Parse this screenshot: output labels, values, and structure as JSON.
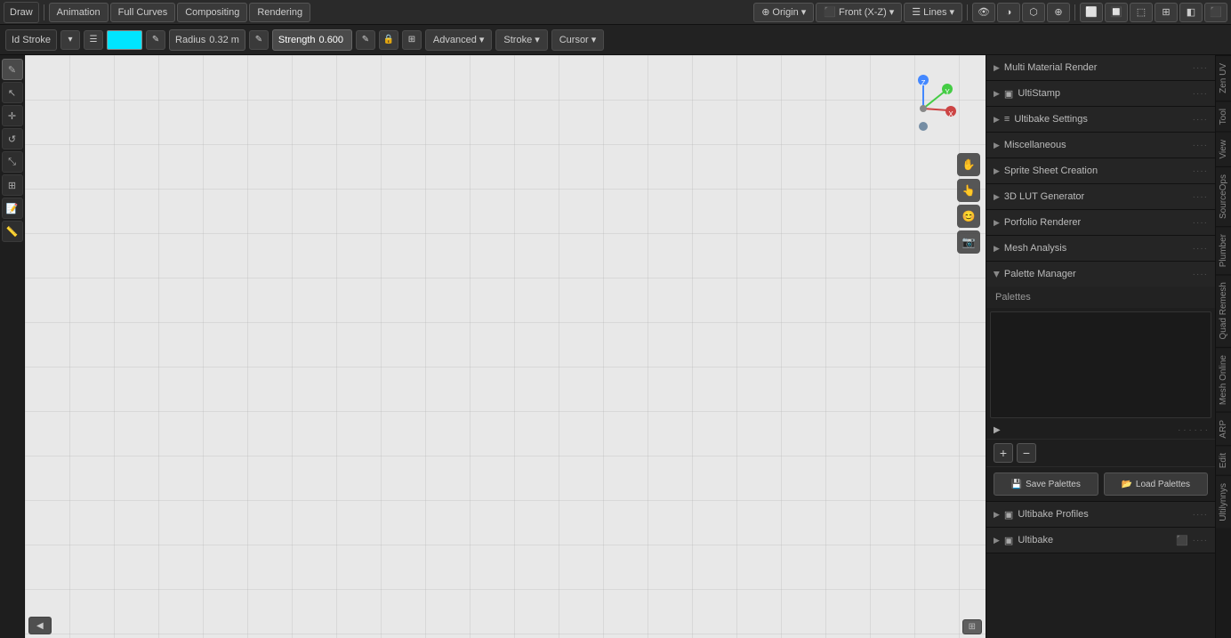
{
  "top_toolbar": {
    "mode_label": "Draw",
    "tabs": [
      "Animation",
      "Full Curves",
      "Compositing",
      "Rendering"
    ],
    "origin_label": "Origin",
    "view_label": "Front (X-Z)",
    "overlay_label": "Lines"
  },
  "secondary_toolbar": {
    "stroke_mode": "Id Stroke",
    "radius_label": "Radius",
    "radius_value": "0.32 m",
    "strength_label": "Strength",
    "strength_value": "0.600",
    "advanced_label": "Advanced",
    "stroke_label": "Stroke",
    "cursor_label": "Cursor"
  },
  "right_panel": {
    "sections": [
      {
        "id": "multi-material-render",
        "label": "Multi Material Render",
        "icon": "",
        "collapsed": true
      },
      {
        "id": "ulti-stamp",
        "label": "UltiStamp",
        "icon": "▣",
        "collapsed": true
      },
      {
        "id": "ultibake-settings",
        "label": "Ultibake Settings",
        "icon": "≡",
        "collapsed": true
      },
      {
        "id": "miscellaneous",
        "label": "Miscellaneous",
        "icon": "",
        "collapsed": true
      },
      {
        "id": "sprite-sheet-creation",
        "label": "Sprite Sheet Creation",
        "icon": "",
        "collapsed": true
      },
      {
        "id": "3d-lut-generator",
        "label": "3D LUT Generator",
        "icon": "",
        "collapsed": true
      },
      {
        "id": "porfolio-renderer",
        "label": "Porfolio Renderer",
        "icon": "",
        "collapsed": true
      },
      {
        "id": "mesh-analysis",
        "label": "Mesh Analysis",
        "icon": "",
        "collapsed": true
      },
      {
        "id": "palette-manager",
        "label": "Palette Manager",
        "icon": "",
        "collapsed": false
      },
      {
        "id": "ultibake-profiles",
        "label": "Ultibake Profiles",
        "icon": "▣",
        "collapsed": true
      },
      {
        "id": "ultibake",
        "label": "Ultibake",
        "icon": "▣",
        "collapsed": true
      }
    ],
    "palette_manager": {
      "palettes_label": "Palettes",
      "save_label": "Save Palettes",
      "load_label": "Load Palettes"
    }
  },
  "side_tabs": [
    {
      "id": "zen-uv",
      "label": "Zen UV"
    },
    {
      "id": "tool",
      "label": "Tool"
    },
    {
      "id": "view",
      "label": "View"
    },
    {
      "id": "sourceops",
      "label": "SourceOps"
    },
    {
      "id": "plumber",
      "label": "Plumber"
    },
    {
      "id": "quad-remesh",
      "label": "Quad Remesh"
    },
    {
      "id": "mesh-online",
      "label": "Mesh Online"
    },
    {
      "id": "arp",
      "label": "ARP"
    },
    {
      "id": "edit",
      "label": "Edit"
    },
    {
      "id": "ultilynnys",
      "label": "Ultilynnys"
    }
  ],
  "viewport": {
    "bottom_left_btn": "◀",
    "bottom_right": "⊞"
  }
}
